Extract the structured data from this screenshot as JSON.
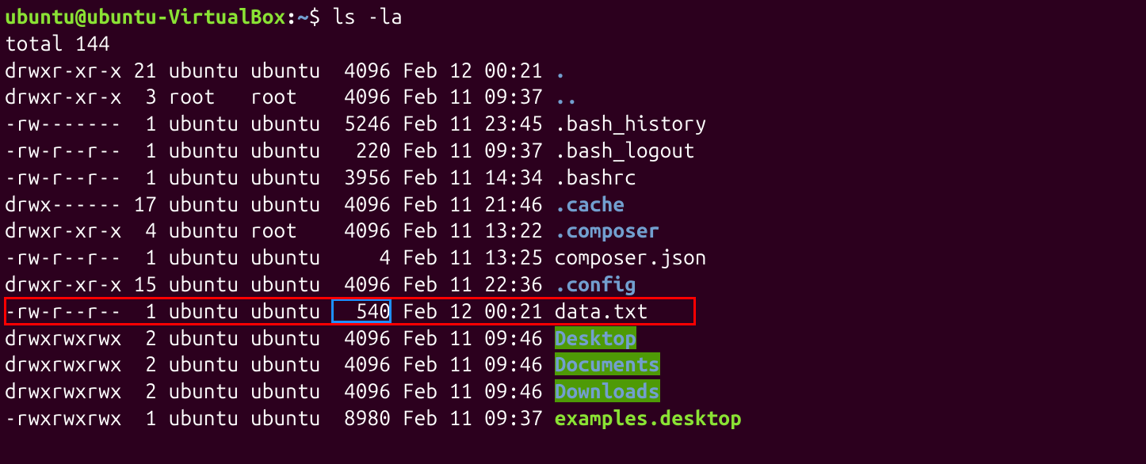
{
  "prompt": {
    "user_host": "ubuntu@ubuntu-VirtualBox",
    "separator": ":",
    "path": "~",
    "dollar": "$",
    "command": "ls -la"
  },
  "total_line": "total 144",
  "rows": [
    {
      "perm": "drwxr-xr-x",
      "links": "21",
      "owner": "ubuntu",
      "group": "ubuntu",
      "size": "4096",
      "date": "Feb 12 00:21",
      "name": ".",
      "type": "dir"
    },
    {
      "perm": "drwxr-xr-x",
      "links": "3",
      "owner": "root",
      "group": "root",
      "size": "4096",
      "date": "Feb 11 09:37",
      "name": "..",
      "type": "dir"
    },
    {
      "perm": "-rw-------",
      "links": "1",
      "owner": "ubuntu",
      "group": "ubuntu",
      "size": "5246",
      "date": "Feb 11 23:45",
      "name": ".bash_history",
      "type": "plain"
    },
    {
      "perm": "-rw-r--r--",
      "links": "1",
      "owner": "ubuntu",
      "group": "ubuntu",
      "size": "220",
      "date": "Feb 11 09:37",
      "name": ".bash_logout",
      "type": "plain"
    },
    {
      "perm": "-rw-r--r--",
      "links": "1",
      "owner": "ubuntu",
      "group": "ubuntu",
      "size": "3956",
      "date": "Feb 11 14:34",
      "name": ".bashrc",
      "type": "plain"
    },
    {
      "perm": "drwx------",
      "links": "17",
      "owner": "ubuntu",
      "group": "ubuntu",
      "size": "4096",
      "date": "Feb 11 21:46",
      "name": ".cache",
      "type": "dir"
    },
    {
      "perm": "drwxr-xr-x",
      "links": "4",
      "owner": "ubuntu",
      "group": "root",
      "size": "4096",
      "date": "Feb 11 13:22",
      "name": ".composer",
      "type": "dir"
    },
    {
      "perm": "-rw-r--r--",
      "links": "1",
      "owner": "ubuntu",
      "group": "ubuntu",
      "size": "4",
      "date": "Feb 11 13:25",
      "name": "composer.json",
      "type": "plain"
    },
    {
      "perm": "drwxr-xr-x",
      "links": "15",
      "owner": "ubuntu",
      "group": "ubuntu",
      "size": "4096",
      "date": "Feb 11 22:36",
      "name": ".config",
      "type": "dir"
    },
    {
      "perm": "-rw-r--r--",
      "links": "1",
      "owner": "ubuntu",
      "group": "ubuntu",
      "size": "540",
      "date": "Feb 12 00:21",
      "name": "data.txt",
      "type": "plain",
      "highlight": "red",
      "size_highlight": "blue"
    },
    {
      "perm": "drwxrwxrwx",
      "links": "2",
      "owner": "ubuntu",
      "group": "ubuntu",
      "size": "4096",
      "date": "Feb 11 09:46",
      "name": "Desktop",
      "type": "exec-bg"
    },
    {
      "perm": "drwxrwxrwx",
      "links": "2",
      "owner": "ubuntu",
      "group": "ubuntu",
      "size": "4096",
      "date": "Feb 11 09:46",
      "name": "Documents",
      "type": "exec-bg"
    },
    {
      "perm": "drwxrwxrwx",
      "links": "2",
      "owner": "ubuntu",
      "group": "ubuntu",
      "size": "4096",
      "date": "Feb 11 09:46",
      "name": "Downloads",
      "type": "exec-bg"
    },
    {
      "perm": "-rwxrwxrwx",
      "links": "1",
      "owner": "ubuntu",
      "group": "ubuntu",
      "size": "8980",
      "date": "Feb 11 09:37",
      "name": "examples.desktop",
      "type": "exec-green"
    }
  ]
}
